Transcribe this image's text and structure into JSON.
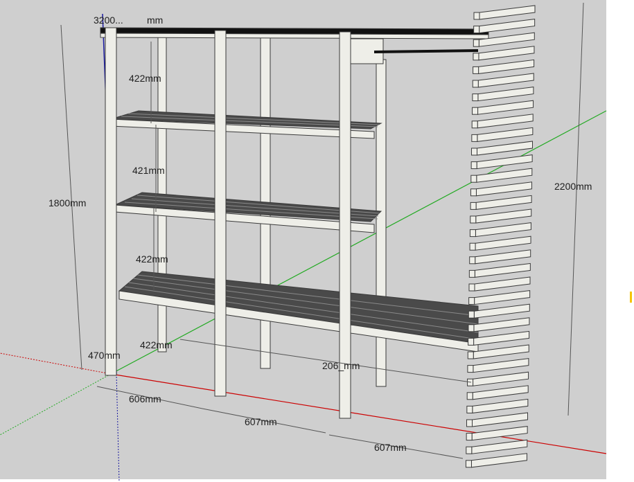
{
  "app": {
    "name": "3D model viewport"
  },
  "colors": {
    "background": "#cfcfcf",
    "wood_face": "#eeeee8",
    "wood_edge": "#3a3a3a",
    "slat_dark": "#4a4a4a",
    "axis_red": "#cc0000",
    "axis_green": "#22aa22",
    "axis_blue": "#1a1aa0",
    "cursor": "#f5c400"
  },
  "dimensions": {
    "top_overlap": "3200...",
    "top_overlap2": "mm",
    "shelf_gap_top": "422mm",
    "shelf_gap_2": "421mm",
    "shelf_gap_3": "422mm",
    "shelf_gap_bottom": "422mm",
    "height_left": "1800mm",
    "height_right": "2200mm",
    "depth": "470mm",
    "width_1": "606mm",
    "width_2": "607mm",
    "width_3": "607mm",
    "total_width": "206_mm"
  }
}
